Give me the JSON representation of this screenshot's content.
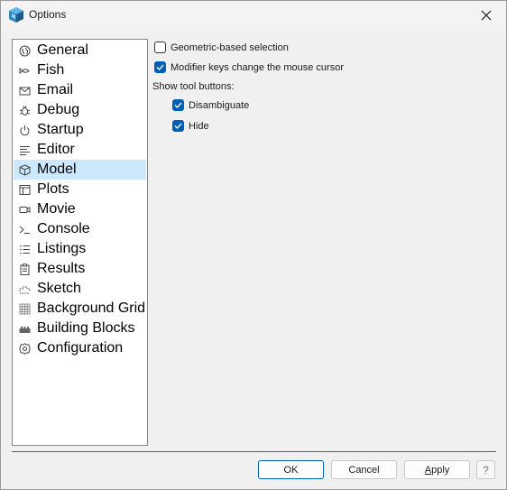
{
  "window": {
    "title": "Options"
  },
  "sidebar": {
    "items": [
      {
        "label": "General",
        "icon": "globe-icon",
        "selected": false
      },
      {
        "label": "Fish",
        "icon": "fish-icon",
        "selected": false
      },
      {
        "label": "Email",
        "icon": "envelope-icon",
        "selected": false
      },
      {
        "label": "Debug",
        "icon": "bug-icon",
        "selected": false
      },
      {
        "label": "Startup",
        "icon": "power-icon",
        "selected": false
      },
      {
        "label": "Editor",
        "icon": "text-lines-icon",
        "selected": false
      },
      {
        "label": "Model",
        "icon": "cube-icon",
        "selected": true
      },
      {
        "label": "Plots",
        "icon": "panel-layout-icon",
        "selected": false
      },
      {
        "label": "Movie",
        "icon": "video-camera-icon",
        "selected": false
      },
      {
        "label": "Console",
        "icon": "terminal-prompt-icon",
        "selected": false
      },
      {
        "label": "Listings",
        "icon": "bulleted-list-icon",
        "selected": false
      },
      {
        "label": "Results",
        "icon": "clipboard-icon",
        "selected": false
      },
      {
        "label": "Sketch",
        "icon": "dotted-sketch-icon",
        "selected": false
      },
      {
        "label": "Background Grid",
        "icon": "grid-icon",
        "selected": false
      },
      {
        "label": "Building Blocks",
        "icon": "blocks-icon",
        "selected": false
      },
      {
        "label": "Configuration",
        "icon": "gear-icon",
        "selected": false
      }
    ]
  },
  "model_panel": {
    "geometric_selection": {
      "label": "Geometric-based selection",
      "checked": false
    },
    "modifier_keys": {
      "label": "Modifier keys change the mouse cursor",
      "checked": true
    },
    "tool_buttons_heading": "Show tool buttons:",
    "disambiguate": {
      "label": "Disambiguate",
      "checked": true
    },
    "hide": {
      "label": "Hide",
      "checked": true
    }
  },
  "buttons": {
    "ok": "OK",
    "cancel": "Cancel",
    "apply": "Apply",
    "help": "?"
  },
  "colors": {
    "accent": "#005fb8",
    "selection": "#cce8ff"
  }
}
